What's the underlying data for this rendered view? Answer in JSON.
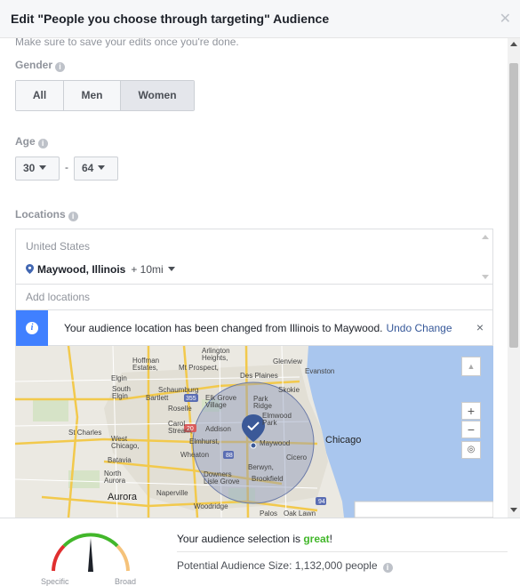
{
  "header": {
    "title": "Edit \"People you choose through targeting\" Audience",
    "close_icon": "close-icon"
  },
  "notes": {
    "save_hint": "Make sure to save your edits once you're done."
  },
  "gender": {
    "label": "Gender",
    "options": [
      "All",
      "Men",
      "Women"
    ],
    "selected": "Women"
  },
  "age": {
    "label": "Age",
    "min": "30",
    "max": "64",
    "separator": "-"
  },
  "locations": {
    "label": "Locations",
    "country": "United States",
    "city": "Maywood, Illinois",
    "radius": "+ 10mi",
    "add_placeholder": "Add locations"
  },
  "notice": {
    "message": "Your audience location has been changed from Illinois to Maywood.",
    "undo": "Undo Change",
    "close": "×"
  },
  "map": {
    "labels": {
      "arlington": "Arlington\nHeights,",
      "hoffman": "Hoffman\nEstates,",
      "mtprospect": "Mt Prospect,",
      "glenview": "Glenview",
      "evanston": "Evanston",
      "desplaines": "Des Plaines",
      "elgin": "Elgin",
      "southelgin": "South\nElgin",
      "schaumburg": "Schaumburg",
      "bartlett": "Bartlett",
      "elkgrove": "Elk Grove\nVillage",
      "parkridge": "Park\nRidge",
      "skokie": "Skokie",
      "roselle": "Roselle",
      "elmwood": "Elmwood\nPark",
      "carol": "Carol\nStream,",
      "addison": "Addison",
      "stcharles": "St Charles",
      "westchicago": "West\nChicago,",
      "elmhurst": "Elmhurst,",
      "maywood": "Maywood",
      "chicago": "Chicago",
      "batavia": "Batavia",
      "wheaton": "Wheaton",
      "cicero": "Cicero",
      "berwyn": "Berwyn,",
      "northaurora": "North\nAurora",
      "downers": "Downers\nLisle Grove",
      "brookfield": "Brookfield",
      "aurora": "Aurora",
      "naperville": "Naperville",
      "woodridge": "Woodridge",
      "palos": "Palos",
      "oaklawn": "Oak Lawn",
      "r355": "355",
      "r88": "88",
      "r94": "94",
      "r20": "20"
    },
    "controls": {
      "zoom_in": "+",
      "zoom_out": "−"
    }
  },
  "footer": {
    "selection_prefix": "Your audience selection is ",
    "selection_value": "great",
    "selection_suffix": "!",
    "size": "Potential Audience Size: 1,132,000 people",
    "specific": "Specific",
    "broad": "Broad",
    "gauge_level": 0.5
  },
  "colors": {
    "accent": "#4080ff",
    "link": "#365899",
    "great": "#42b72a",
    "water": "#a9c6ee",
    "radius_fill": "#8d9bbf"
  }
}
